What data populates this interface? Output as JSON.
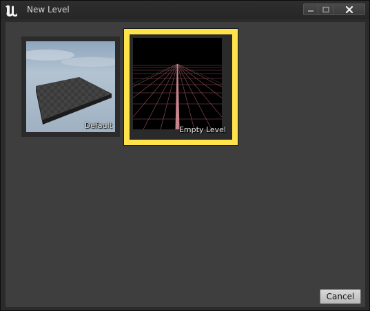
{
  "window": {
    "title": "New Level",
    "logo_icon": "unreal-engine-logo",
    "controls": {
      "minimize_icon": "minimize-icon",
      "maximize_icon": "maximize-icon",
      "close_icon": "close-icon"
    }
  },
  "templates": [
    {
      "label": "Default",
      "selected": false
    },
    {
      "label": "Empty Level",
      "selected": true
    }
  ],
  "footer": {
    "cancel_label": "Cancel"
  },
  "colors": {
    "selection": "#ffe34a",
    "panel": "#3e3e3e",
    "titlebar": "#2b2b2b"
  }
}
